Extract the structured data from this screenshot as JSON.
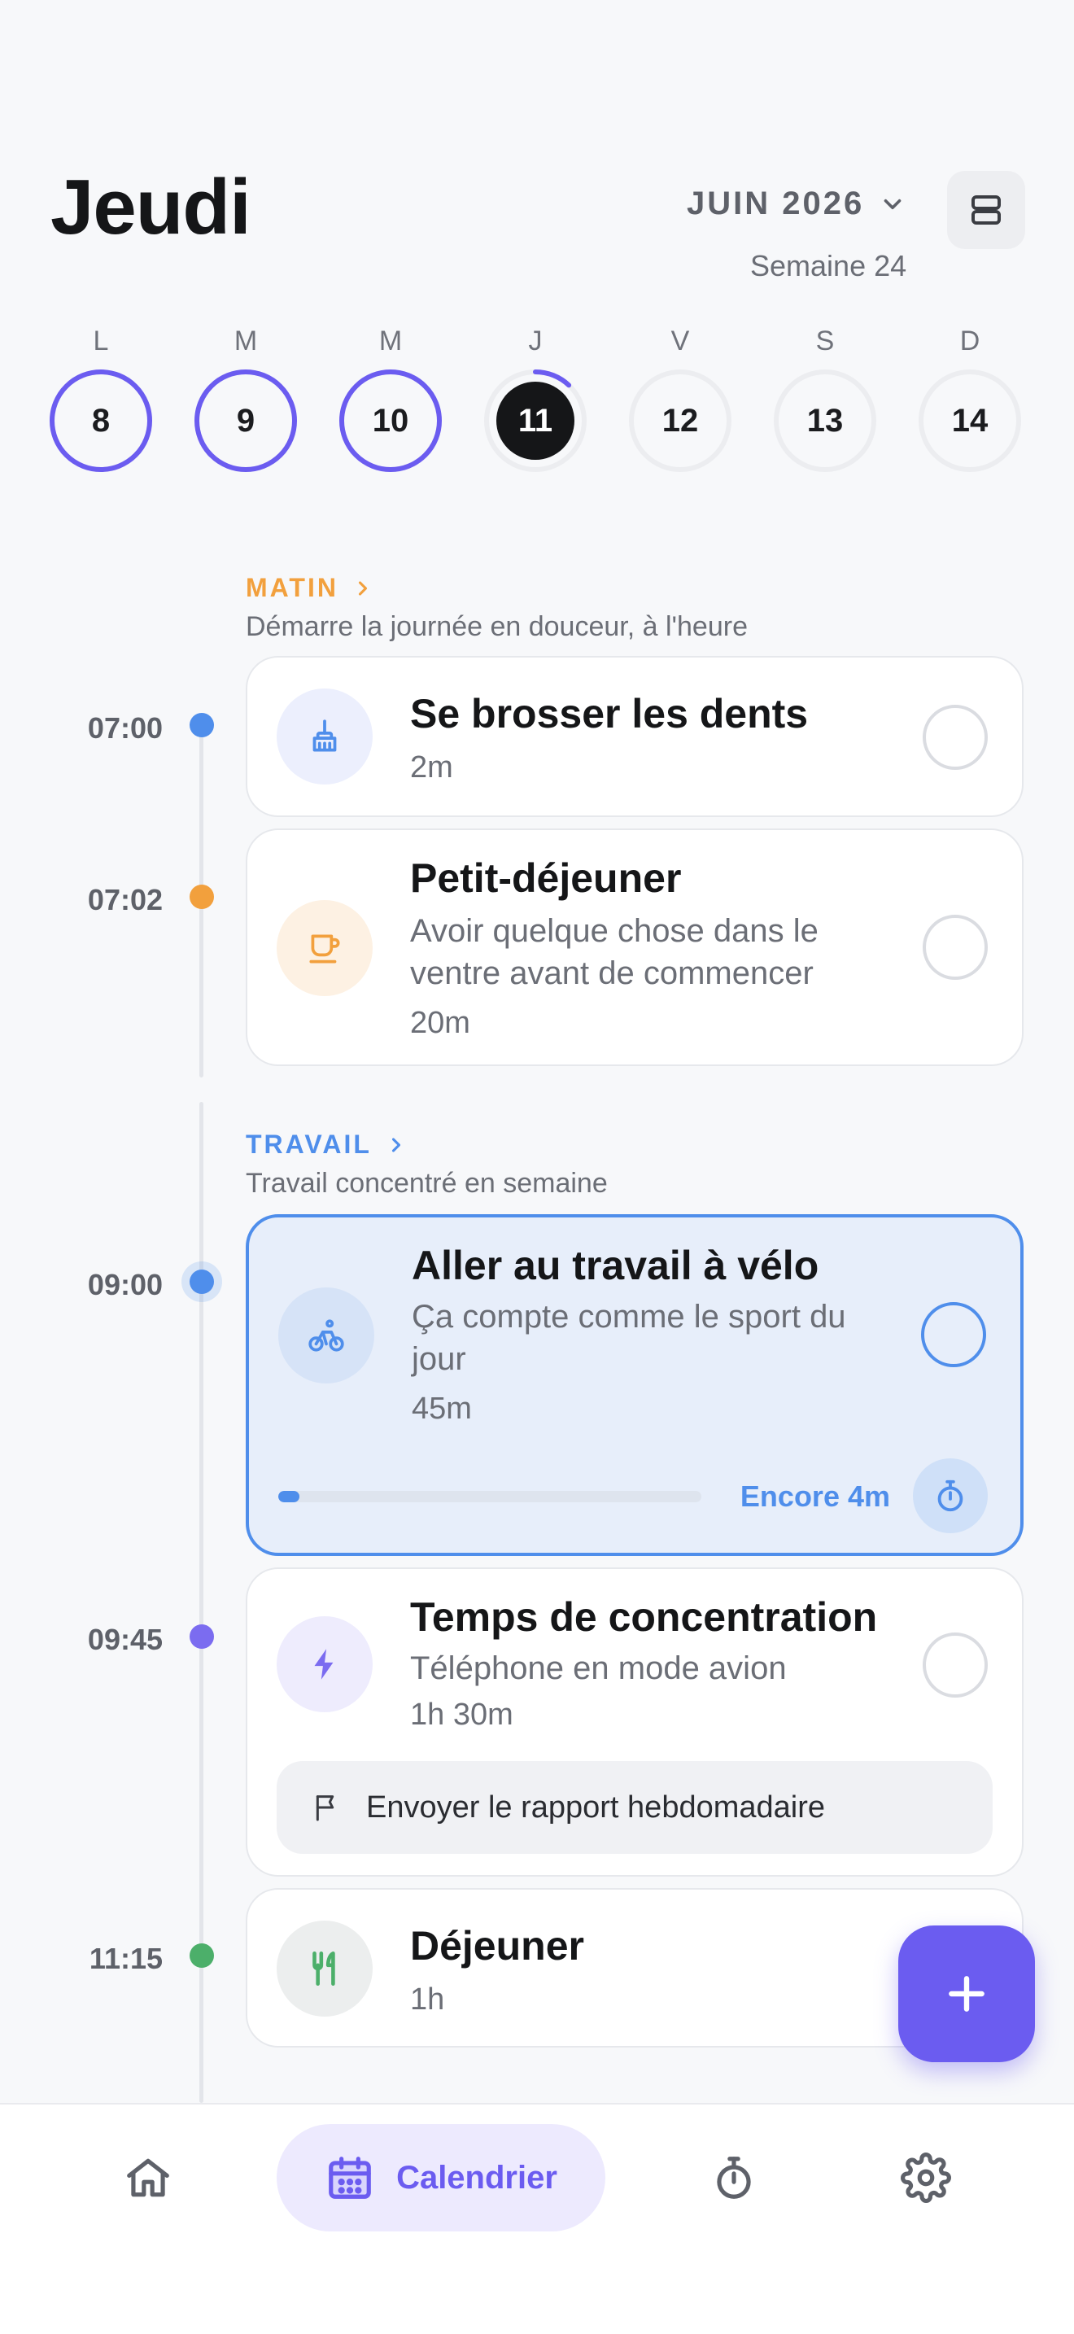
{
  "header": {
    "day_title": "Jeudi",
    "month_label": "JUIN 2026",
    "week_label": "Semaine 24",
    "view_toggle_icon": "layout-rows-icon",
    "month_chevron_icon": "chevron-down-icon"
  },
  "week": [
    {
      "letter": "L",
      "day": "8",
      "progress": 1.0
    },
    {
      "letter": "M",
      "day": "9",
      "progress": 1.0
    },
    {
      "letter": "M",
      "day": "10",
      "progress": 1.0
    },
    {
      "letter": "J",
      "day": "11",
      "progress": 0.12,
      "today": true
    },
    {
      "letter": "V",
      "day": "12",
      "progress": 0
    },
    {
      "letter": "S",
      "day": "13",
      "progress": 0
    },
    {
      "letter": "D",
      "day": "14",
      "progress": 0
    }
  ],
  "sections": {
    "morning": {
      "name": "MATIN",
      "description": "Démarre la journée en douceur, à l'heure",
      "color": "#F2A03D"
    },
    "work": {
      "name": "TRAVAIL",
      "description": "Travail concentré en semaine",
      "color": "#4F8EEB"
    }
  },
  "tasks": [
    {
      "time": "07:00",
      "title": "Se brosser les dents",
      "duration": "2m",
      "icon": "brush-icon",
      "color": "#4F8EEB",
      "icon_bg": "#ECEFFD"
    },
    {
      "time": "07:02",
      "title": "Petit-déjeuner",
      "desc_line1": "Avoir quelque chose dans le",
      "desc_line2": "ventre avant de commencer",
      "duration": "20m",
      "icon": "coffee-cup-icon",
      "color": "#F2A03D",
      "icon_bg": "#FDF1E3"
    },
    {
      "time": "09:00",
      "title": "Aller au travail à vélo",
      "desc_line1": "Ça compte comme le sport du",
      "desc_line2": "jour",
      "duration": "45m",
      "icon": "bicycle-icon",
      "color": "#4F8EEB",
      "icon_bg": "#D6E3F7",
      "active": true,
      "progress": 0.05,
      "remaining": "Encore 4m"
    },
    {
      "time": "09:45",
      "title": "Temps de concentration",
      "desc_line1": "Téléphone en mode avion",
      "duration": "1h 30m",
      "icon": "lightning-icon",
      "color": "#7B6CF0",
      "icon_bg": "#EEECFD",
      "subtask": "Envoyer le rapport hebdomadaire"
    },
    {
      "time": "11:15",
      "title": "Déjeuner",
      "duration": "1h",
      "icon": "fork-knife-icon",
      "color": "#4CAF6A",
      "icon_bg": "#ECEEEE"
    }
  ],
  "nav": {
    "items": [
      {
        "icon": "home-icon"
      },
      {
        "icon": "calendar-icon",
        "label": "Calendrier",
        "active": true
      },
      {
        "icon": "stopwatch-icon"
      },
      {
        "icon": "gear-icon"
      }
    ]
  },
  "fab_icon": "plus-icon",
  "colors": {
    "accent": "#6B5CF0",
    "active_blue": "#4F8EEB"
  }
}
